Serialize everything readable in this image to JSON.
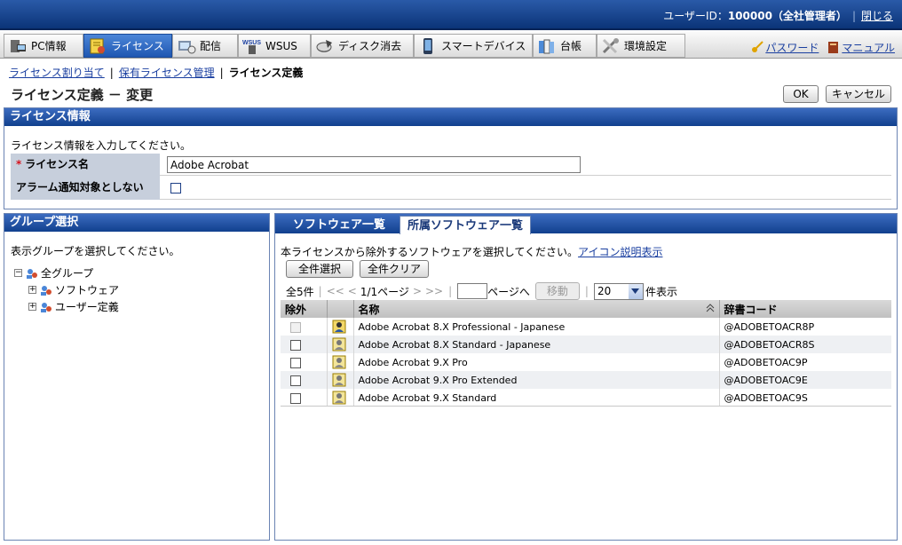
{
  "header": {
    "user_label": "ユーザーID：",
    "user_value": "100000（全社管理者）",
    "close_link": "閉じる"
  },
  "menu": {
    "tabs": [
      {
        "label": "PC情報",
        "icon": "pc-icon"
      },
      {
        "label": "ライセンス",
        "icon": "license-icon"
      },
      {
        "label": "配信",
        "icon": "delivery-icon"
      },
      {
        "label": "WSUS",
        "icon": "wsus-icon"
      },
      {
        "label": "ディスク消去",
        "icon": "disk-erase-icon"
      },
      {
        "label": "スマートデバイス",
        "icon": "smart-device-icon"
      },
      {
        "label": "台帳",
        "icon": "ledger-icon"
      },
      {
        "label": "環境設定",
        "icon": "settings-icon"
      }
    ],
    "password_link": "パスワード",
    "manual_link": "マニュアル"
  },
  "breadcrumb": {
    "item1": "ライセンス割り当て",
    "item2": "保有ライセンス管理",
    "current": "ライセンス定義"
  },
  "page": {
    "title": "ライセンス定義 － 変更",
    "ok": "OK",
    "cancel": "キャンセル"
  },
  "license_info": {
    "heading": "ライセンス情報",
    "help": "ライセンス情報を入力してください。",
    "name_label": "ライセンス名",
    "name_value": "Adobe Acrobat",
    "alarm_label": "アラーム通知対象としない"
  },
  "group_select": {
    "heading": "グループ選択",
    "help": "表示グループを選択してください。",
    "tree": [
      {
        "label": "全グループ",
        "expander": "−"
      },
      {
        "label": "ソフトウェア",
        "expander": "+"
      },
      {
        "label": "ユーザー定義",
        "expander": "+"
      }
    ]
  },
  "software": {
    "tab_list": "ソフトウェア一覧",
    "tab_owned": "所属ソフトウェア一覧",
    "help": "本ライセンスから除外するソフトウェアを選択してください。",
    "icon_help_link": "アイコン説明表示",
    "select_all": "全件選択",
    "clear_all": "全件クリア",
    "pager": {
      "total": "全5件",
      "first": "<<",
      "prev": "<",
      "page_info": "1/1ページ",
      "next": ">",
      "last": ">>",
      "goto_label": "ページへ",
      "move": "移動",
      "per_page": "20",
      "per_page_suffix": "件表示"
    },
    "columns": {
      "exclude": "除外",
      "name": "名称",
      "code": "辞書コード"
    },
    "rows": [
      {
        "name": "Adobe Acrobat 8.X Professional - Japanese",
        "code": "@ADOBETOACR8P",
        "disabled": true
      },
      {
        "name": "Adobe Acrobat 8.X Standard - Japanese",
        "code": "@ADOBETOACR8S",
        "disabled": false
      },
      {
        "name": "Adobe Acrobat 9.X Pro",
        "code": "@ADOBETOAC9P",
        "disabled": false
      },
      {
        "name": "Adobe Acrobat 9.X Pro Extended",
        "code": "@ADOBETOAC9E",
        "disabled": false
      },
      {
        "name": "Adobe Acrobat 9.X Standard",
        "code": "@ADOBETOAC9S",
        "disabled": false
      }
    ]
  }
}
